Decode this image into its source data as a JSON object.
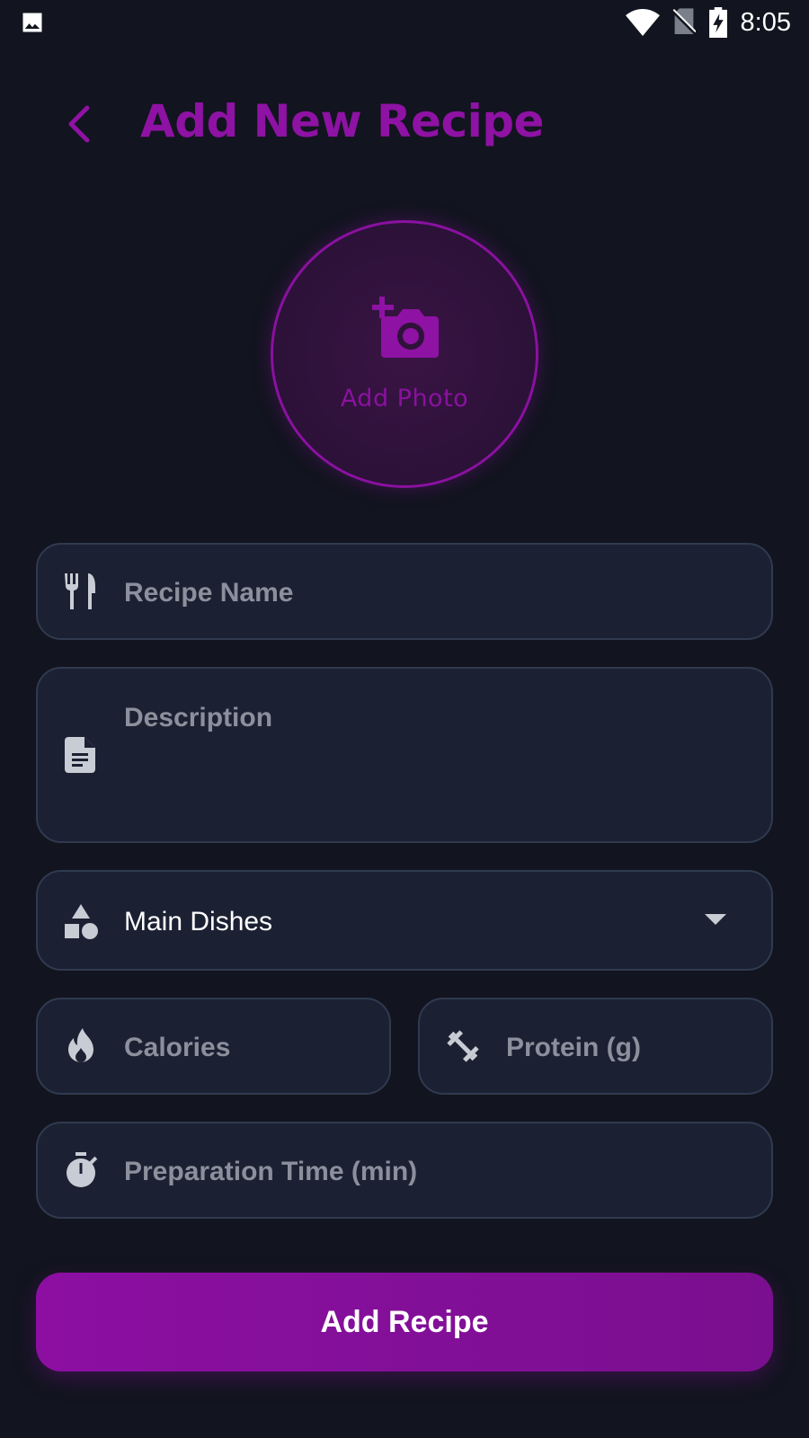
{
  "status_bar": {
    "time": "8:05",
    "icons": [
      "image-icon",
      "wifi-icon",
      "no-sim-icon",
      "battery-charging-icon"
    ]
  },
  "header": {
    "title": "Add New Recipe",
    "back_icon": "chevron-left-icon"
  },
  "photo": {
    "label": "Add Photo",
    "icon": "add-camera-icon"
  },
  "form": {
    "recipe_name": {
      "placeholder": "Recipe Name",
      "icon": "fork-knife-icon"
    },
    "description": {
      "placeholder": "Description",
      "icon": "document-icon"
    },
    "category": {
      "value": "Main Dishes",
      "icon": "category-shapes-icon",
      "arrow": "dropdown-arrow-icon"
    },
    "calories": {
      "placeholder": "Calories",
      "icon": "flame-icon"
    },
    "protein": {
      "placeholder": "Protein (g)",
      "icon": "dumbbell-icon"
    },
    "prep_time": {
      "placeholder": "Preparation Time (min)",
      "icon": "stopwatch-icon"
    }
  },
  "submit": {
    "label": "Add Recipe"
  },
  "colors": {
    "background": "#12141f",
    "accent": "#8e12a3",
    "field_bg": "#1b2133",
    "field_border": "#303a4f",
    "placeholder": "#8b909c"
  }
}
